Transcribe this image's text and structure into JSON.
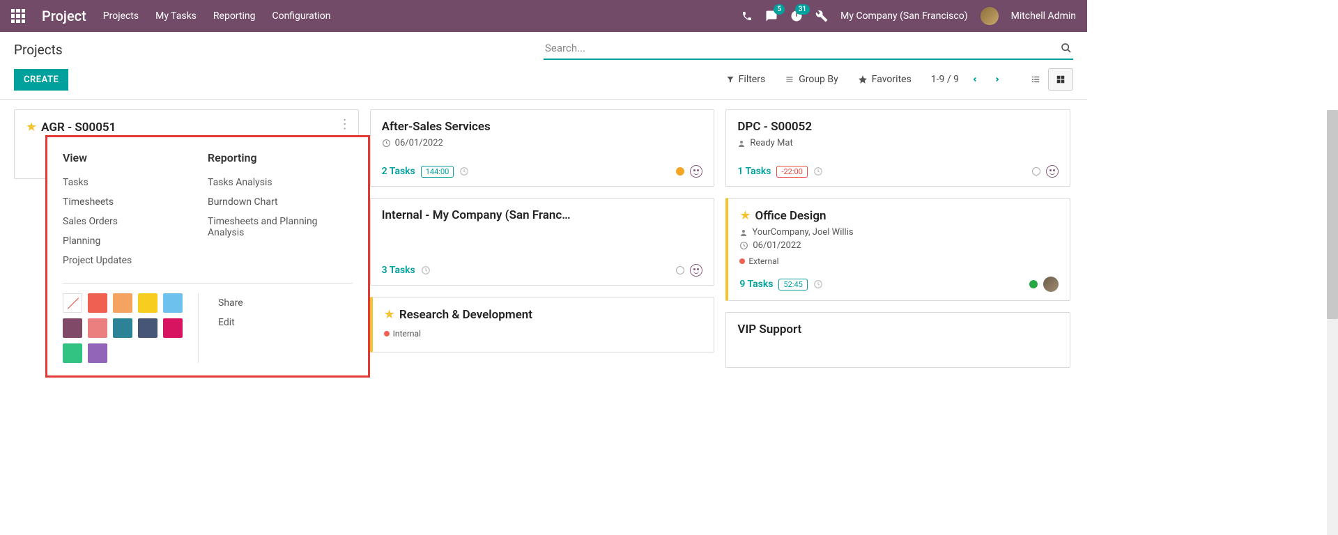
{
  "navbar": {
    "brand": "Project",
    "links": [
      "Projects",
      "My Tasks",
      "Reporting",
      "Configuration"
    ],
    "chat_badge": "5",
    "activity_badge": "31",
    "company": "My Company (San Francisco)",
    "user": "Mitchell Admin"
  },
  "controlPanel": {
    "breadcrumb": "Projects",
    "search_placeholder": "Search...",
    "create_label": "CREATE",
    "filters_label": "Filters",
    "groupby_label": "Group By",
    "favorites_label": "Favorites",
    "pager": "1-9 / 9"
  },
  "popover": {
    "view_heading": "View",
    "reporting_heading": "Reporting",
    "view_items": [
      "Tasks",
      "Timesheets",
      "Sales Orders",
      "Planning",
      "Project Updates"
    ],
    "reporting_items": [
      "Tasks Analysis",
      "Burndown Chart",
      "Timesheets and Planning Analysis"
    ],
    "share_label": "Share",
    "edit_label": "Edit",
    "colors": [
      "none",
      "#F06050",
      "#F4A460",
      "#F7CD1F",
      "#6CC1ED",
      "#814968",
      "#EB7E7F",
      "#2C8397",
      "#475577",
      "#D6145F",
      "#30C381",
      "#9365B8"
    ]
  },
  "cards": {
    "agr": {
      "title": "AGR - S00051"
    },
    "after_sales": {
      "title": "After-Sales Services",
      "date": "06/01/2022",
      "tasks_label": "2 Tasks",
      "time": "144:00"
    },
    "dpc": {
      "title": "DPC - S00052",
      "customer": "Ready Mat",
      "tasks_label": "1 Tasks",
      "time": "-22:00"
    },
    "internal": {
      "title": "Internal - My Company (San Franc…",
      "tasks_label": "3 Tasks"
    },
    "office": {
      "title": "Office Design",
      "customer": "YourCompany, Joel Willis",
      "date": "06/01/2022",
      "tag": "External",
      "tasks_label": "9 Tasks",
      "time": "52:45"
    },
    "research": {
      "title": "Research & Development",
      "tag": "Internal"
    },
    "vip": {
      "title": "VIP Support"
    }
  }
}
